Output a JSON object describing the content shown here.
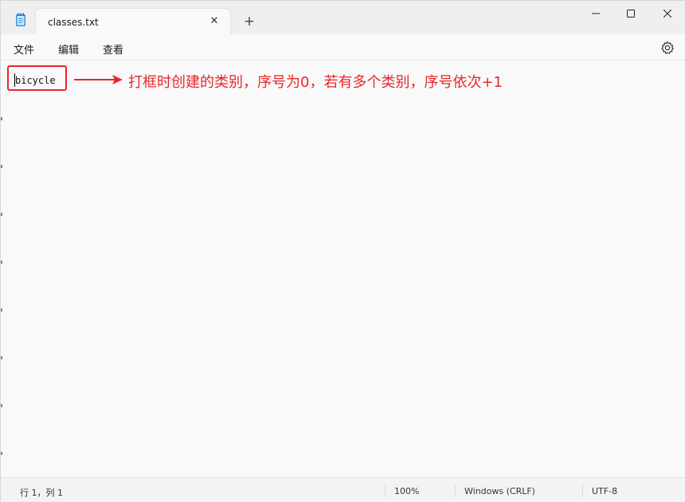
{
  "tab": {
    "title": "classes.txt",
    "close_glyph": "✕",
    "new_tab_glyph": "+"
  },
  "menu": {
    "file": "文件",
    "edit": "编辑",
    "view": "查看"
  },
  "editor": {
    "content": "bicycle"
  },
  "annotation": {
    "text": "打框时创建的类别，序号为0，若有多个类别，序号依次+1",
    "color": "#e8262b"
  },
  "status": {
    "position": "行 1，列 1",
    "zoom": "100%",
    "line_ending": "Windows (CRLF)",
    "encoding": "UTF-8"
  },
  "icons": {
    "app": "notepad-icon",
    "settings": "gear-icon",
    "minimize": "minimize-icon",
    "maximize": "maximize-icon",
    "close": "close-icon"
  }
}
